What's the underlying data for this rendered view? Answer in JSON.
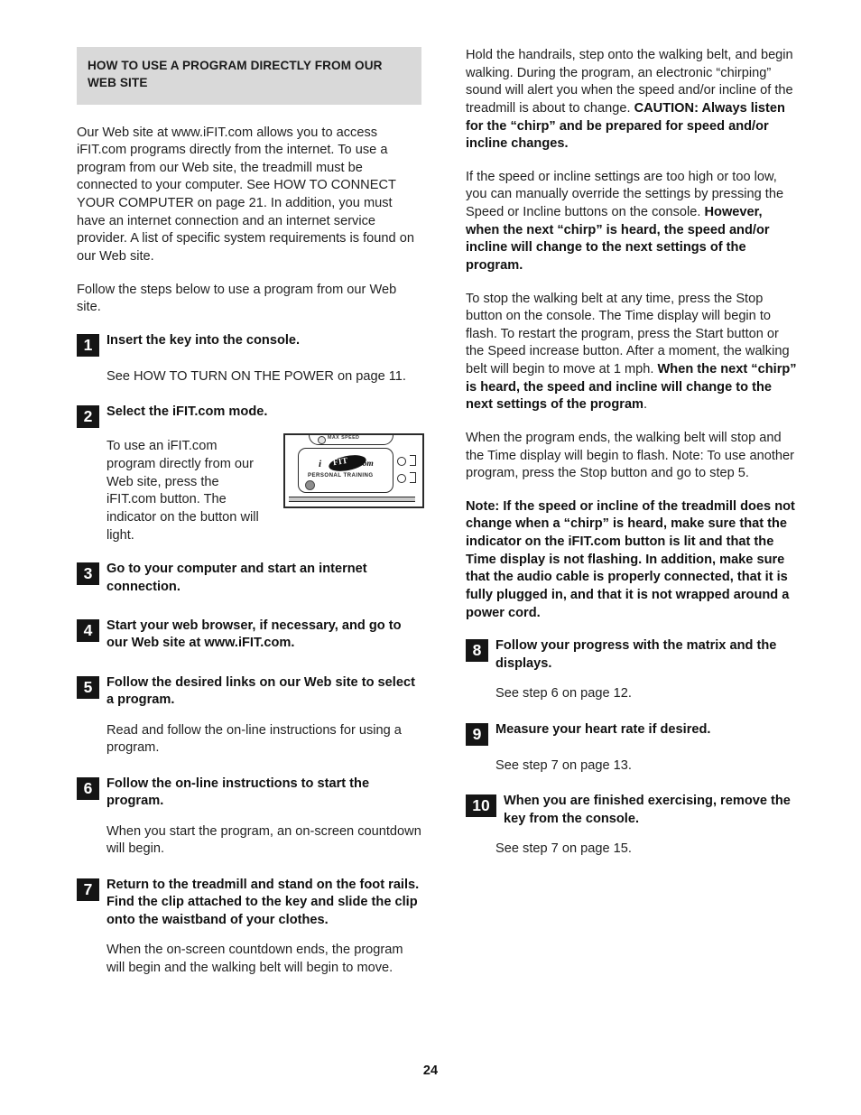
{
  "page": {
    "number": "24"
  },
  "left_column": {
    "section_header": "HOW TO USE A PROGRAM DIRECTLY FROM OUR WEB SITE",
    "intro_paragraph": "Our Web site at www.iFIT.com allows you to access iFIT.com programs directly from the internet. To use a program from our Web site, the treadmill must be connected to your computer. See HOW TO CONNECT YOUR COMPUTER on page 21. In addition, you must have an internet connection and an internet service provider. A list of specific system requirements is found on our Web site.",
    "follow_steps_paragraph": "Follow the steps below to use a program from our Web site.",
    "steps": [
      {
        "number": "1",
        "title": "Insert the key into the console.",
        "body": "See HOW TO TURN ON THE POWER on page 11."
      },
      {
        "number": "2",
        "title": "Select the iFIT.com mode.",
        "body": "To use an iFIT.com program directly from our Web site, press the iFIT.com button. The indicator on the button will light."
      },
      {
        "number": "3",
        "title": "Go to your computer and start an internet connection.",
        "body": ""
      },
      {
        "number": "4",
        "title": "Start your web browser, if necessary, and go to our Web site at www.iFIT.com.",
        "body": ""
      },
      {
        "number": "5",
        "title": "Follow the desired links on our Web site to select a program.",
        "body": "Read and follow the on-line instructions for using a program."
      },
      {
        "number": "6",
        "title": "Follow the on-line instructions to start the program.",
        "body": "When you start the program, an on-screen countdown will begin."
      },
      {
        "number": "7",
        "title": "Return to the treadmill and stand on the foot rails. Find the clip attached to the key and slide the clip onto the waistband of your clothes.",
        "body": "When the on-screen countdown ends, the program will begin and the walking belt will begin to move."
      }
    ],
    "console_figure": {
      "max_speed_label": "MAX SPEED",
      "logo_i": "i",
      "logo_fit": "FIT",
      "logo_com": ".com",
      "logo_subtitle": "PERSONAL TRAINING"
    }
  },
  "right_column": {
    "para_1_plain": "Hold the handrails, step onto the walking belt, and begin walking. During the program, an electronic “chirping” sound will alert you when the speed and/or incline of the treadmill is about to change. ",
    "para_1_bold": "CAUTION: Always listen for the “chirp” and be prepared for speed and/or incline changes.",
    "para_2_plain": "If the speed or incline settings are too high or too low, you can manually override the settings by pressing the Speed or Incline buttons on the console. ",
    "para_2_bold": "However, when the next “chirp” is heard, the speed and/or incline will change to the next settings of the program.",
    "para_3_plain": "To stop the walking belt at any time, press the Stop button on the console. The Time display will begin to flash. To restart the program, press the Start button or the Speed increase button. After a moment, the walking belt will begin to move at 1 mph. ",
    "para_3_bold": "When the next “chirp” is heard, the speed and incline will change to the next settings of the program",
    "para_3_tail": ".",
    "para_4": "When the program ends, the walking belt will stop and the Time display will begin to flash. Note: To use another program, press the Stop button and go to step 5.",
    "note_paragraph": "Note: If the speed or incline of the treadmill does not change when a “chirp” is heard, make sure that the indicator on the iFIT.com button is lit and that the Time display is not flashing. In addition, make sure that the audio cable is properly connected, that it is fully plugged in, and that it is not wrapped around a power cord.",
    "steps": [
      {
        "number": "8",
        "title": "Follow your progress with the matrix and the displays.",
        "body": "See step 6 on page 12."
      },
      {
        "number": "9",
        "title": "Measure your heart rate if desired.",
        "body": "See step 7 on page 13."
      },
      {
        "number": "10",
        "title": "When you are finished exercising, remove the key from the console.",
        "body": "See step 7 on page 15."
      }
    ]
  },
  "colors": {
    "header_background": "#d9d9d9",
    "badge_background": "#151515",
    "badge_text": "#ffffff",
    "body_text": "#1f1f1f",
    "page_background": "#ffffff"
  }
}
